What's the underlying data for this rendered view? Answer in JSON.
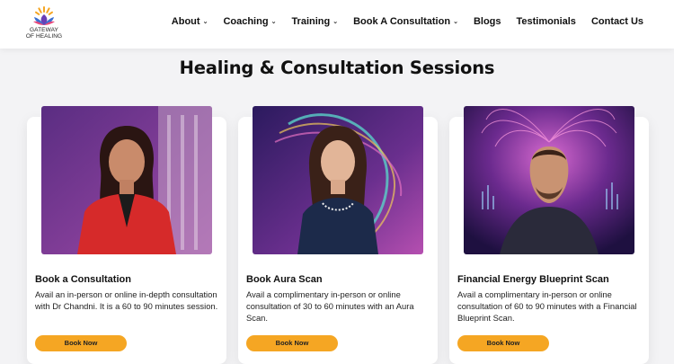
{
  "brand": {
    "logo_line1": "GATEWAY",
    "logo_line2": "OF HEALING",
    "icon": "lotus-logo-icon"
  },
  "nav": {
    "items": [
      {
        "label": "About",
        "has_dropdown": true
      },
      {
        "label": "Coaching",
        "has_dropdown": true
      },
      {
        "label": "Training",
        "has_dropdown": true
      },
      {
        "label": "Book A Consultation",
        "has_dropdown": true
      },
      {
        "label": "Blogs",
        "has_dropdown": false
      },
      {
        "label": "Testimonials",
        "has_dropdown": false
      },
      {
        "label": "Contact Us",
        "has_dropdown": false
      }
    ]
  },
  "main": {
    "title": "Healing & Consultation Sessions",
    "cards": [
      {
        "title": "Book a Consultation",
        "description": "Avail an in-person or online in-depth consultation with Dr Chandni. It is a 60 to 90 minutes session.",
        "button": "Book Now"
      },
      {
        "title": "Book Aura Scan",
        "description": "Avail a complimentary in-person or online consultation of 30 to 60 minutes with an Aura Scan.",
        "button": "Book Now"
      },
      {
        "title": "Financial Energy Blueprint Scan",
        "description": "Avail a complimentary in-person or online consultation of 60 to 90 minutes with a Financial Blueprint Scan.",
        "button": "Book Now"
      }
    ]
  },
  "colors": {
    "accent": "#f5a623",
    "background": "#f3f3f5",
    "text": "#111111"
  }
}
